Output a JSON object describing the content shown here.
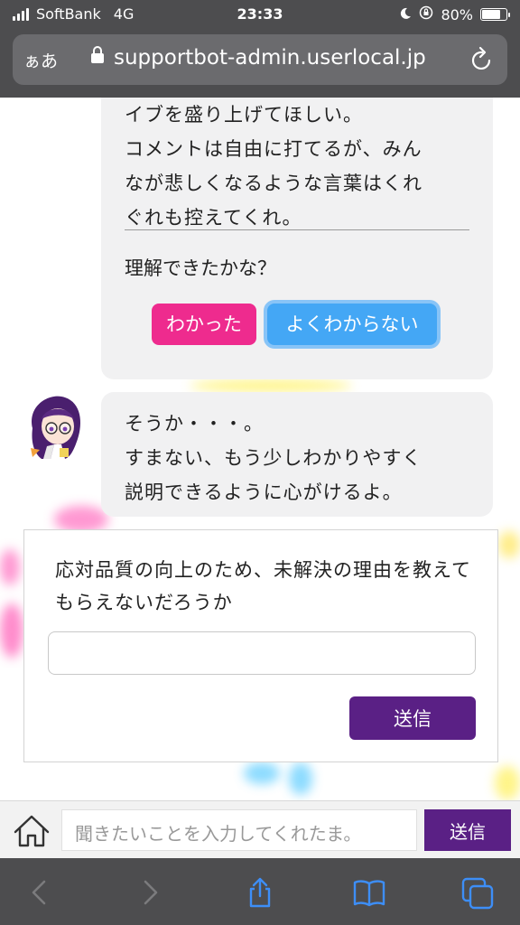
{
  "status_bar": {
    "carrier": "SoftBank",
    "network": "4G",
    "time": "23:33",
    "battery": "80%",
    "battery_level": 0.8
  },
  "url_bar": {
    "text_size_label": "ぁあ",
    "url": "supportbot-admin.userlocal.jp"
  },
  "chat": {
    "bubble1": {
      "text": "イブを盛り上げてほしい。\nコメントは自由に打てるが、みん\nなが悲しくなるような言葉はくれ\nぐれも控えてくれ。",
      "question": "理解できたかな？",
      "choice_yes": "わかった",
      "choice_no": "よくわからない"
    },
    "bubble2": {
      "text": "そうか・・・。\nすまない、もう少しわかりやすく\n説明できるように心がけるよ。"
    },
    "survey": {
      "question": "応対品質の向上のため、未解決の理由を教えてもらえないだろうか",
      "input_value": "",
      "send_label": "送信"
    }
  },
  "input_bar": {
    "placeholder": "聞きたいことを入力してくれたま。",
    "send_label": "送信"
  },
  "toolbar": {
    "icons": [
      "back-icon",
      "forward-icon",
      "share-icon",
      "bookmarks-icon",
      "tabs-icon"
    ]
  },
  "colors": {
    "accent_purple": "#5a2085",
    "choice_pink": "#ee2b8e",
    "choice_blue": "#44a7f5",
    "chrome_gray": "#4d4d4f"
  }
}
